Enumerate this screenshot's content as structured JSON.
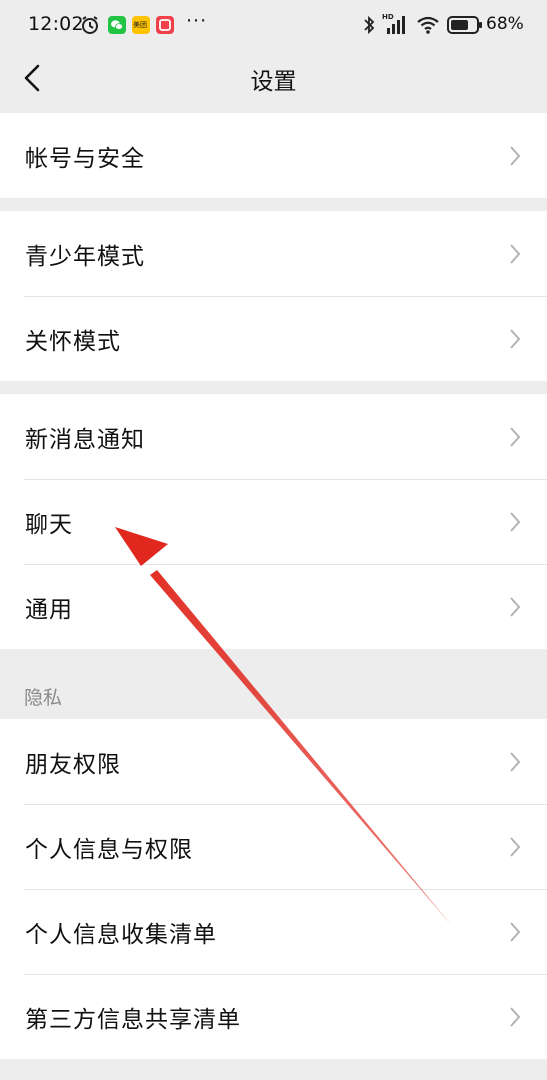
{
  "status_bar": {
    "time": "12:02",
    "more": "···",
    "battery_percent": "68%",
    "icons": [
      "alarm-icon",
      "wechat-app-icon",
      "meituan-app-icon",
      "red-app-icon",
      "bluetooth-icon",
      "signal-hd-icon",
      "wifi-icon",
      "battery-icon"
    ],
    "app_badges": {
      "meituan": "美团"
    },
    "signal_label": "HD"
  },
  "nav": {
    "title": "设置",
    "back_icon": "chevron-left-icon"
  },
  "groups": [
    {
      "items": [
        {
          "label": "帐号与安全"
        }
      ]
    },
    {
      "items": [
        {
          "label": "青少年模式"
        },
        {
          "label": "关怀模式"
        }
      ]
    },
    {
      "items": [
        {
          "label": "新消息通知"
        },
        {
          "label": "聊天"
        },
        {
          "label": "通用"
        }
      ]
    },
    {
      "header": "隐私",
      "items": [
        {
          "label": "朋友权限"
        },
        {
          "label": "个人信息与权限"
        },
        {
          "label": "个人信息收集清单"
        },
        {
          "label": "第三方信息共享清单"
        }
      ]
    }
  ],
  "annotation": {
    "type": "arrow",
    "color": "#e0281e",
    "points_to": "聊天"
  },
  "colors": {
    "background": "#ededed",
    "row_background": "#ffffff",
    "divider": "#e5e5e5",
    "chevron": "#b2b2b2",
    "section_header": "#8a8a8a"
  }
}
